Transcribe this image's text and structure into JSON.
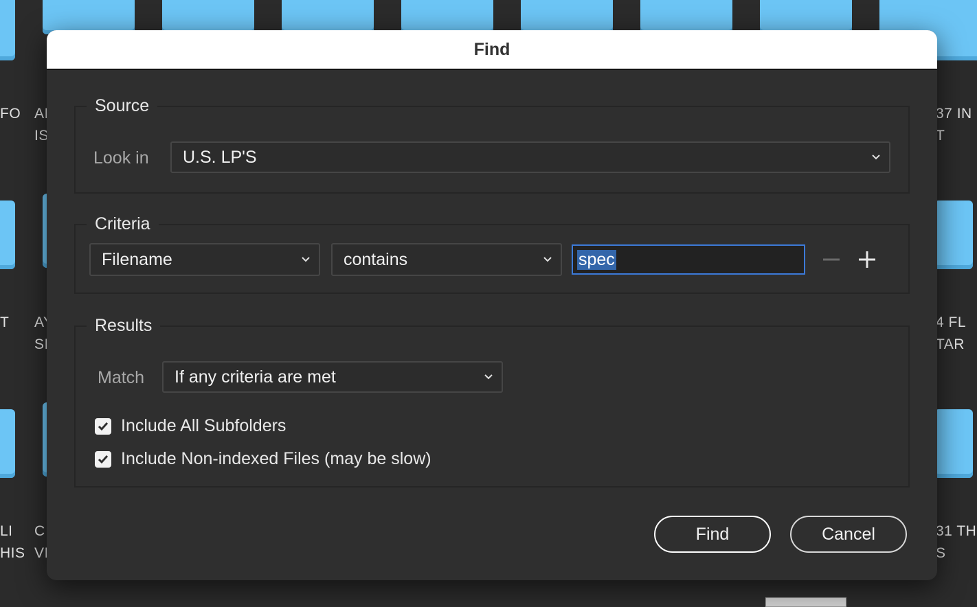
{
  "background": {
    "labels_left_col1": [
      "FO",
      "T",
      "LI\nHIS"
    ],
    "labels_left_col2": [
      "AI\nIS",
      "AY\nSI",
      "C\nVI"
    ],
    "labels_right": [
      "37 IN\nT",
      "4 FL\nTAR",
      "31 TH\nS"
    ]
  },
  "dialog": {
    "title": "Find",
    "source": {
      "group_title": "Source",
      "look_in_label": "Look in",
      "look_in_value": "U.S. LP'S"
    },
    "criteria": {
      "group_title": "Criteria",
      "field_value": "Filename",
      "operator_value": "contains",
      "text_value": "spec"
    },
    "results": {
      "group_title": "Results",
      "match_label": "Match",
      "match_value": "If any criteria are met",
      "include_subfolders_label": "Include All Subfolders",
      "include_subfolders_checked": true,
      "include_nonindexed_label": "Include Non-indexed Files (may be slow)",
      "include_nonindexed_checked": true
    },
    "buttons": {
      "find_label": "Find",
      "cancel_label": "Cancel"
    }
  },
  "colors": {
    "accent_focus": "#3c7ad8",
    "folder": "#6cc5f5",
    "dialog_bg": "#2f2f2f"
  }
}
